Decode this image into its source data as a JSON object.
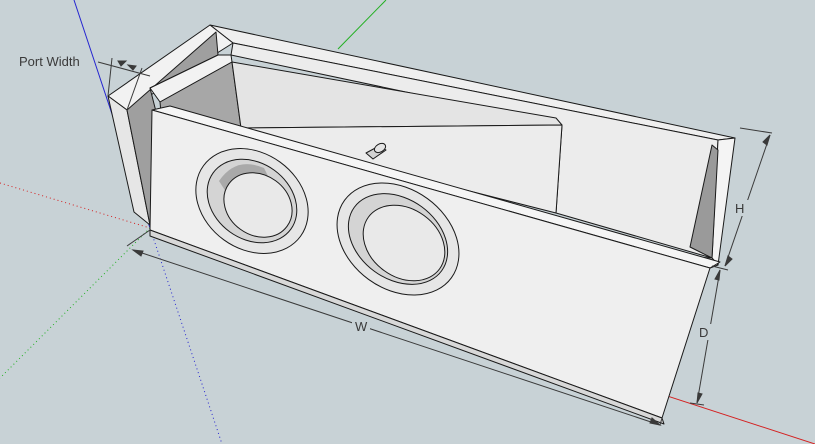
{
  "model": {
    "labels": {
      "port_width": "Port Width",
      "width": "W",
      "height": "H",
      "depth": "D"
    }
  },
  "colors": {
    "background": "#c8d2d6",
    "face_light": "#f0f0f0",
    "face_mid": "#e2e2e2",
    "face_shadow": "#a9a9a9",
    "edge": "#1a1a1a",
    "axis_red": "#d42020",
    "axis_green": "#23b023",
    "axis_blue": "#2424d0",
    "dimension_line": "#3a3a3a"
  }
}
